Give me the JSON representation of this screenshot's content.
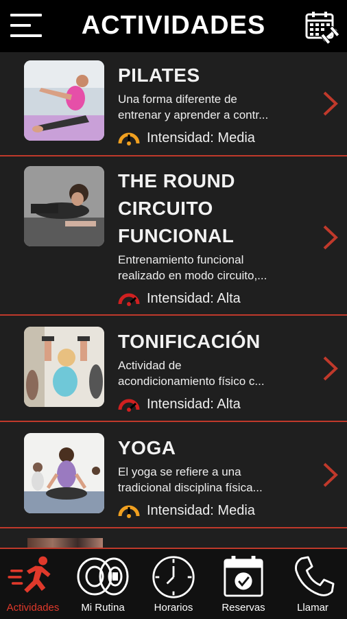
{
  "header": {
    "title": "ACTIVIDADES"
  },
  "activities": [
    {
      "title": "PILATES",
      "desc_line1": "Una forma diferente de",
      "desc_line2": "entrenar y aprender a contr...",
      "intensity": "Intensidad: Media",
      "level": "media"
    },
    {
      "title_line1": "THE ROUND",
      "title_line2": "CIRCUITO",
      "title_line3": "FUNCIONAL",
      "desc_line1": "Entrenamiento funcional",
      "desc_line2": "realizado en modo circuito,...",
      "intensity": "Intensidad: Alta",
      "level": "alta"
    },
    {
      "title": "TONIFICACIÓN",
      "desc_line1": "Actividad de",
      "desc_line2": "acondicionamiento físico c...",
      "intensity": "Intensidad: Alta",
      "level": "alta"
    },
    {
      "title": "YOGA",
      "desc_line1": "El yoga se refiere a una",
      "desc_line2": "tradicional disciplina física...",
      "intensity": "Intensidad: Media",
      "level": "media"
    }
  ],
  "tabs": [
    {
      "label": "Actividades",
      "icon": "running-man-icon",
      "active": true
    },
    {
      "label": "Mi Rutina",
      "icon": "weight-plates-icon",
      "active": false
    },
    {
      "label": "Horarios",
      "icon": "clock-icon",
      "active": false
    },
    {
      "label": "Reservas",
      "icon": "calendar-check-icon",
      "active": false
    },
    {
      "label": "Llamar",
      "icon": "phone-icon",
      "active": false
    }
  ],
  "colors": {
    "accent": "#c0392b",
    "active_tab": "#e0392b",
    "gauge_media": "#f0a020",
    "gauge_alta": "#d02020"
  }
}
